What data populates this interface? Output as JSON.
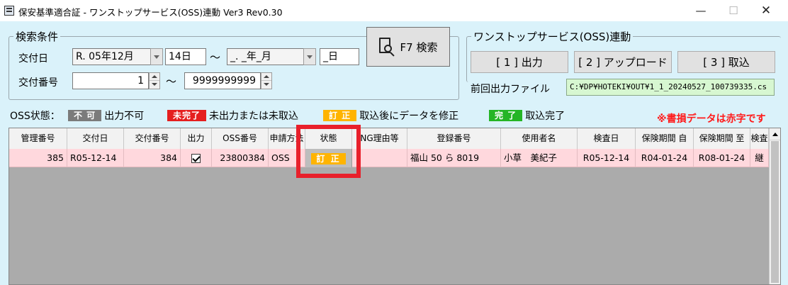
{
  "window": {
    "title": "保安基準適合証 - ワンストップサービス(OSS)連動 Ver3 Rev0.30",
    "minimize_symbol": "—",
    "maximize_symbol": "☐",
    "close_symbol": "✕"
  },
  "search": {
    "group_title": "検索条件",
    "issue_date_label": "交付日",
    "date_from_era": "R. 05年12月",
    "date_from_day": "14日",
    "date_to_era": "_. _年_月",
    "date_to_day": "_日",
    "issue_no_label": "交付番号",
    "issue_no_from": "1",
    "issue_no_to": "9999999999",
    "tilde": "～",
    "search_button": "F7 検索"
  },
  "oss": {
    "group_title": "ワンストップサービス(OSS)連動",
    "output_button": "[ 1 ] 出力",
    "upload_button": "[ 2 ] アップロード",
    "import_button": "[ 3 ] 取込",
    "last_output_label": "前回出力ファイル",
    "last_output_path": "C:¥DP¥HOTEKI¥OUT¥1_1_20240527_100739335.cs"
  },
  "legend": {
    "label": "OSS状態：",
    "items": [
      {
        "badge": "不 可",
        "text": "出力不可"
      },
      {
        "badge": "未完了",
        "text": "未出力または未取込"
      },
      {
        "badge": "訂 正",
        "text": "取込後にデータを修正"
      },
      {
        "badge": "完 了",
        "text": "取込完了"
      }
    ],
    "note": "※書損データは赤字です"
  },
  "table": {
    "headers": [
      "管理番号",
      "交付日",
      "交付番号",
      "出力",
      "OSS番号",
      "申請方法",
      "状態",
      "NG理由等",
      "登録番号",
      "使用者名",
      "検査日",
      "保険期間 自",
      "保険期間 至",
      "検査"
    ],
    "rows": [
      {
        "mgmt_no": "385",
        "issue_date": "R05-12-14",
        "issue_no": "384",
        "output_checked": true,
        "oss_no": "23800384",
        "method": "OSS",
        "status": "訂 正",
        "ng_reason": "",
        "reg_no": "福山 50 ら 8019",
        "user_name": "小草　美紀子",
        "inspection_date": "R05-12-14",
        "ins_from": "R04-01-24",
        "ins_to": "R08-01-24",
        "inspection_extra": "継"
      }
    ]
  },
  "colors": {
    "background": "#daf2fa",
    "badge_gray": "#7b7b7b",
    "badge_red": "#e51f1f",
    "badge_orange": "#ffb400",
    "badge_green": "#25b525",
    "row_pink": "#ffd8dd",
    "path_green": "#d7f7d1",
    "highlight_red": "#e8202b"
  },
  "icons": {
    "search": "document-search-icon",
    "dropdown": "chevron-down-icon",
    "spinner": "spin-up-down-icon"
  }
}
